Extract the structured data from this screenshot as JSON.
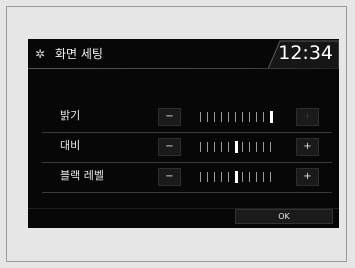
{
  "header": {
    "title": "화면 세팅",
    "time": "12:34",
    "icon": "gear-icon"
  },
  "settings": [
    {
      "label": "밝기",
      "minus": "−",
      "plus": "+",
      "level": 11,
      "max": 11,
      "plus_enabled": false
    },
    {
      "label": "대비",
      "minus": "−",
      "plus": "+",
      "level": 6,
      "max": 11,
      "plus_enabled": true
    },
    {
      "label": "블랙 레벨",
      "minus": "−",
      "plus": "+",
      "level": 6,
      "max": 11,
      "plus_enabled": true
    }
  ],
  "ok_label": "OK"
}
